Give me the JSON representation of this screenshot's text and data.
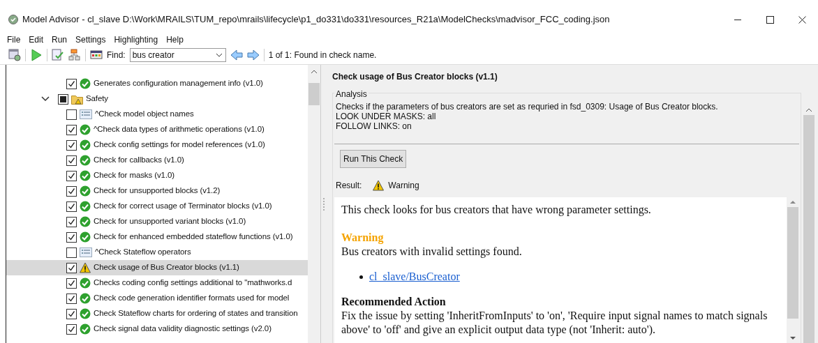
{
  "window": {
    "title": "Model Advisor - cl_slave  D:\\Work\\MRAILS\\TUM_repo\\mrails\\lifecycle\\p1_do331\\do331\\resources_R21a\\ModelChecks\\madvisor_FCC_coding.json"
  },
  "menu": [
    "File",
    "Edit",
    "Run",
    "Settings",
    "Highlighting",
    "Help"
  ],
  "toolbar": {
    "find_label": "Find:",
    "find_value": "bus creator",
    "find_status": "1 of 1: Found in check name."
  },
  "tree": [
    {
      "label": "Generates configuration management info (v1.0)",
      "kind": "pass",
      "checked": true,
      "selected": false
    },
    {
      "label": "Safety",
      "kind": "folder",
      "partial": true,
      "expanded": true,
      "selected": false,
      "children": [
        {
          "label": "^Check model object names",
          "kind": "info",
          "checked": false,
          "selected": false
        },
        {
          "label": "^Check data types of arithmetic operations (v1.0)",
          "kind": "pass",
          "checked": true,
          "selected": false
        },
        {
          "label": "Check config settings for model references (v1.0)",
          "kind": "pass",
          "checked": true,
          "selected": false
        },
        {
          "label": "Check for callbacks (v1.0)",
          "kind": "pass",
          "checked": true,
          "selected": false
        },
        {
          "label": "Check for masks (v1.0)",
          "kind": "pass",
          "checked": true,
          "selected": false
        },
        {
          "label": "Check for unsupported blocks (v1.2)",
          "kind": "pass",
          "checked": true,
          "selected": false
        },
        {
          "label": "Check for correct usage of Terminator blocks (v1.0)",
          "kind": "pass",
          "checked": true,
          "selected": false
        },
        {
          "label": "Check for unsupported variant blocks (v1.0)",
          "kind": "pass",
          "checked": true,
          "selected": false
        },
        {
          "label": "Check for enhanced embedded stateflow functions (v1.0)",
          "kind": "pass",
          "checked": true,
          "selected": false
        },
        {
          "label": "^Check Stateflow operators",
          "kind": "info",
          "checked": false,
          "selected": false
        },
        {
          "label": "Check usage of Bus Creator blocks (v1.1)",
          "kind": "warning",
          "checked": true,
          "selected": true
        },
        {
          "label": "Checks coding config settings additional to \"mathworks.d",
          "kind": "pass",
          "checked": true,
          "selected": false
        },
        {
          "label": "Check code generation identifier formats used for model",
          "kind": "pass",
          "checked": true,
          "selected": false
        },
        {
          "label": "Check Stateflow charts for ordering of states and transition",
          "kind": "pass",
          "checked": true,
          "selected": false
        },
        {
          "label": "Check signal data validity diagnostic settings (v2.0)",
          "kind": "pass",
          "checked": true,
          "selected": false
        }
      ]
    }
  ],
  "detail": {
    "title": "Check usage of Bus Creator blocks (v1.1)",
    "group_label": "Analysis",
    "description": [
      "Checks if the parameters of bus creators are set as requried in fsd_0309: Usage of Bus Creator blocks.",
      "LOOK UNDER MASKS: all",
      "FOLLOW LINKS: on"
    ],
    "run_button": "Run This Check",
    "result_label": "Result:",
    "result": {
      "kind": "warning",
      "text": "Warning"
    },
    "report": {
      "intro": "This check looks for bus creators that have wrong parameter settings.",
      "status_heading": "Warning",
      "status_text": "Bus creators with invalid settings found.",
      "links": [
        "cl_slave/BusCreator"
      ],
      "action_heading": "Recommended Action",
      "action_text": "Fix the issue by setting 'InheritFromInputs' to 'on', 'Require input signal names to match signals above' to 'off' and give an explicit output data type (not 'Inherit: auto')."
    }
  }
}
